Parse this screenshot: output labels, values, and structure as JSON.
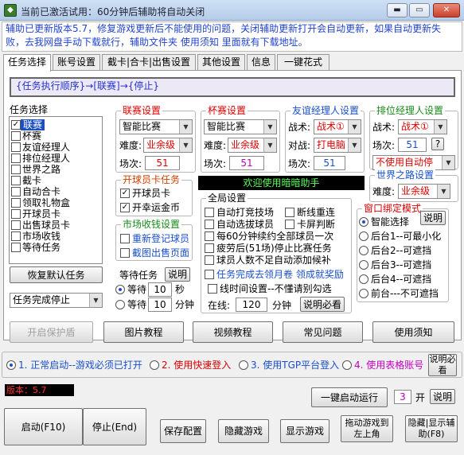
{
  "window": {
    "title": "当前已激活试用：60分钟后辅助将自动关闭",
    "app_icon": "app-icon",
    "min_icon": "minimize-icon",
    "max_icon": "maximize-icon",
    "close_icon": "close-icon",
    "min_glyph": "▬",
    "max_glyph": "▭",
    "close_glyph": "✕"
  },
  "notice": "辅助已更新版本5.7，修复游戏更新后不能使用的问题，关闭辅助更新打开会自动更新，如果自动更新失败，去我网盘手动下载就行，辅助文件夹 使用须知 里面就有下载地址。",
  "tabs": [
    "任务选择",
    "账号设置",
    "截卡|合卡|出售设置",
    "其他设置",
    "信息",
    "一键花式"
  ],
  "flow": "{任务执行顺序}→[联赛]→{停止}",
  "task_list": {
    "title": "任务选择",
    "items": [
      "联赛",
      "杯赛",
      "友谊经理人",
      "排位经理人",
      "世界之路",
      "截卡",
      "自动合卡",
      "领取礼物盒",
      "开球员卡",
      "出售球员卡",
      "市场收钱",
      "等待任务"
    ],
    "selected": "联赛",
    "checked": [
      "联赛"
    ]
  },
  "restore_btn": "恢复默认任务",
  "after_done": "任务完成停止",
  "league": {
    "title": "联赛设置",
    "mode": "智能比赛",
    "diff_label": "难度:",
    "diff": "业余级",
    "count_label": "场次:",
    "count": "51"
  },
  "cup": {
    "title": "杯赛设置",
    "mode": "智能比赛",
    "diff_label": "难度:",
    "diff": "业余级",
    "count_label": "场次:",
    "count": "51"
  },
  "friend": {
    "title": "友谊经理人设置",
    "tactic_label": "战术:",
    "tactic": "战术①",
    "vs_label": "对战:",
    "vs": "打电脑",
    "count_label": "场次:",
    "count": "51"
  },
  "rank": {
    "title": "排位经理人设置",
    "tactic_label": "战术:",
    "tactic": "战术①",
    "count_label": "场次:",
    "count": "51",
    "help": "?",
    "auto": "不使用自动停"
  },
  "world": {
    "title": "世界之路设置",
    "diff_label": "难度:",
    "diff": "业余级"
  },
  "card": {
    "title": "开球员卡任务",
    "items": [
      "开球员卡",
      "开幸运金币"
    ]
  },
  "market": {
    "title": "市场收钱设置",
    "items": [
      "重新登记球员",
      "截图出售页面"
    ]
  },
  "wait": {
    "title": "等待任务",
    "help": "说明",
    "opt1_pre": "等待",
    "opt1_val": "10",
    "opt1_unit": "秒",
    "opt2_pre": "等待",
    "opt2_val": "10",
    "opt2_unit": "分钟"
  },
  "banner": "欢迎使用暗暗助手",
  "global": {
    "title": "全局设置",
    "items": [
      "自动打竞技场",
      "断线重连",
      "自动选拔球员",
      "卡屏判断",
      "每60分钟续约全部球员一次",
      "疲劳后(51场)停止比赛任务",
      "球员人数不足自动添加候补"
    ],
    "claim": "任务完成去领月卷 领成就奖励",
    "limit": "线时间设置--不懂请别勾选",
    "online_label": "在线:",
    "online": "120",
    "online_unit": "分钟",
    "help": "说明必看"
  },
  "bind": {
    "title": "窗口绑定模式",
    "help": "说明",
    "items": [
      "智能选择",
      "后台1--可最小化",
      "后台2--可遮挡",
      "后台3--可遮挡",
      "后台4--可遮挡",
      "前台---不可遮挡"
    ]
  },
  "tool_btns": [
    "开启保护盾",
    "图片教程",
    "视频教程",
    "常见问题",
    "使用须知"
  ],
  "modes": [
    "1. 正常启动--游戏必须已打开",
    "2. 使用快速登入",
    "3. 使用TGP平台登入",
    "4. 使用表格账号"
  ],
  "mode_help": "说明必看",
  "version": "版本：5.7",
  "one_key": "一键启动运行",
  "one_key_val": "3",
  "one_key_unit": "开",
  "one_key_help": "说明",
  "bottom_btns": [
    "启动(F10)",
    "停止(End)",
    "保存配置",
    "隐藏游戏",
    "显示游戏",
    "拖动游戏到左上角",
    "隐藏|显示辅助(F8)"
  ],
  "colors": {
    "accent": "#1e4fbf",
    "red": "#dd0000",
    "green": "#1a8a1a",
    "purple": "#c000c0"
  }
}
